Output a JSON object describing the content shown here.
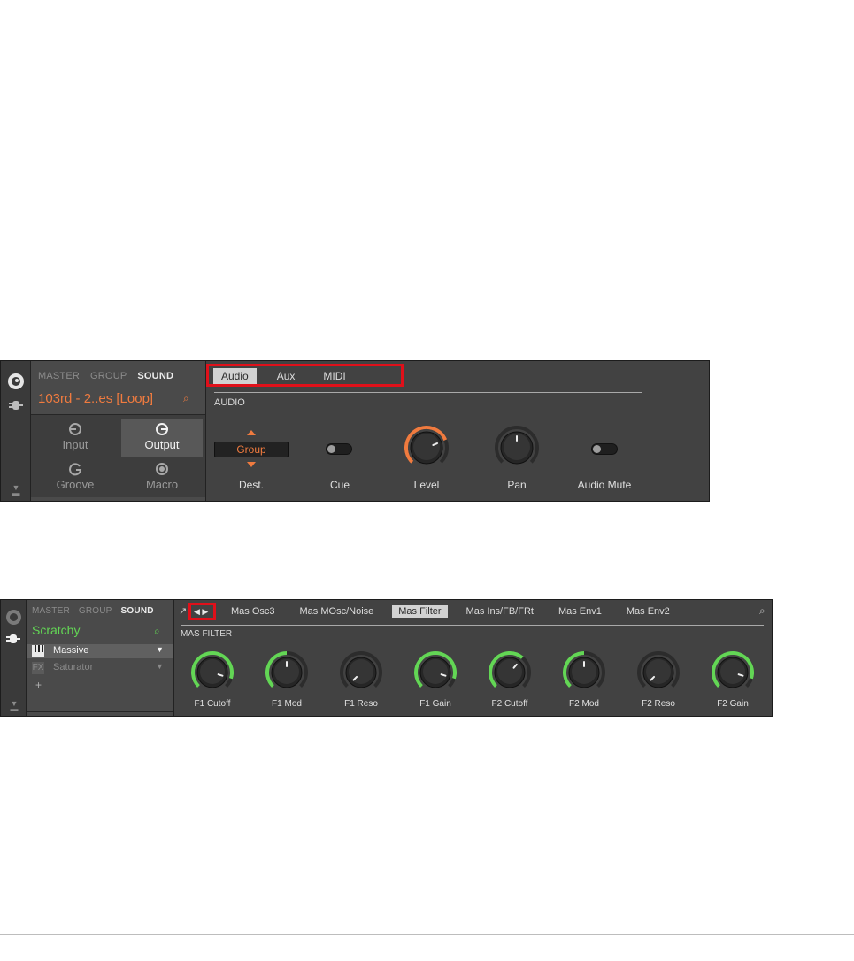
{
  "panel1": {
    "levels": [
      "MASTER",
      "GROUP",
      "SOUND"
    ],
    "active_level": "SOUND",
    "sound_name": "103rd - 2..es [Loop]",
    "pages": [
      {
        "label": "Input",
        "glyph": "◉",
        "selected": false
      },
      {
        "label": "Output",
        "glyph": "◉",
        "selected": true
      },
      {
        "label": "Groove",
        "glyph": "G",
        "selected": false
      },
      {
        "label": "Macro",
        "glyph": "◎",
        "selected": false
      }
    ],
    "tabs": [
      "Audio",
      "Aux",
      "MIDI"
    ],
    "active_tab": "Audio",
    "section_title": "AUDIO",
    "dest_value": "Group",
    "labels": {
      "dest": "Dest.",
      "cue": "Cue",
      "level": "Level",
      "pan": "Pan",
      "audio_mute": "Audio Mute"
    },
    "knobs": {
      "level": 0.75,
      "pan": 0.5
    },
    "accent": "#f07b3f"
  },
  "panel2": {
    "levels": [
      "MASTER",
      "GROUP",
      "SOUND"
    ],
    "active_level": "SOUND",
    "sound_name": "Scratchy",
    "plugins": [
      {
        "name": "Massive",
        "icon": "piano-icon",
        "selected": true
      },
      {
        "name": "Saturator",
        "icon": "fx-icon",
        "selected": false
      }
    ],
    "add_label": "+",
    "tabs": [
      "Mas Osc3",
      "Mas MOsc/Noise",
      "Mas Filter",
      "Mas Ins/FB/FRt",
      "Mas Env1",
      "Mas Env2"
    ],
    "active_tab": "Mas Filter",
    "section_title": "MAS FILTER",
    "knobs": [
      {
        "label": "F1 Cutoff",
        "value": 0.9
      },
      {
        "label": "F1 Mod",
        "value": 0.5
      },
      {
        "label": "F1 Reso",
        "value": 0.0
      },
      {
        "label": "F1 Gain",
        "value": 0.9
      },
      {
        "label": "F2 Cutoff",
        "value": 0.65
      },
      {
        "label": "F2 Mod",
        "value": 0.5
      },
      {
        "label": "F2 Reso",
        "value": 0.0
      },
      {
        "label": "F2 Gain",
        "value": 0.9
      }
    ],
    "accent": "#63d655"
  }
}
